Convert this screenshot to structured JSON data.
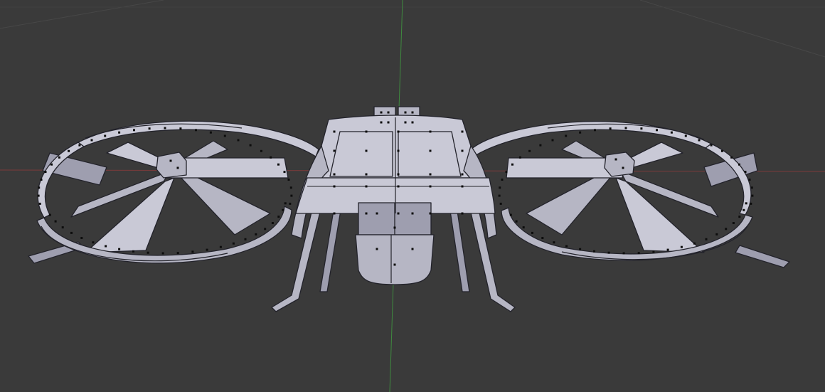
{
  "viewport": {
    "background": "#3a3a3a",
    "grid_line_color": "#4a4a4a",
    "x_axis_color": "#8a3a3a",
    "y_axis_color": "#3f8a3f",
    "mode": "mesh-edit-wireframe",
    "object": "drone-mesh",
    "mesh_face_color": "#b6b6c4",
    "mesh_edge_color": "#23232b",
    "vertex_color": "#0d0d0d"
  }
}
